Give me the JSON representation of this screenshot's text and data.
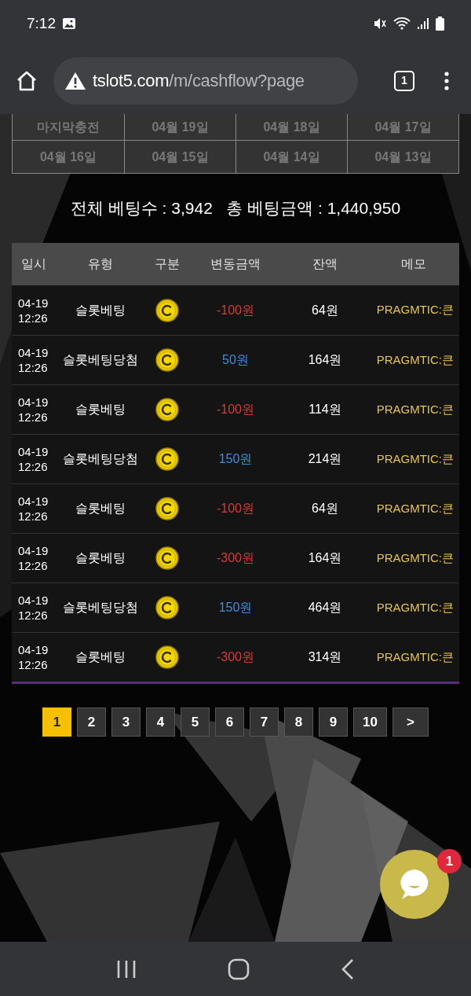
{
  "status_bar": {
    "time": "7:12"
  },
  "browser": {
    "url_host": "tslot5.com",
    "url_path": "/m/cashflow?page",
    "tab_count": "1"
  },
  "date_filters": [
    {
      "label": "마지막충전",
      "selected": false
    },
    {
      "label": "04월 19일",
      "selected": false
    },
    {
      "label": "04월 18일",
      "selected": false
    },
    {
      "label": "04월 17일",
      "selected": false
    },
    {
      "label": "04월 16일",
      "selected": false
    },
    {
      "label": "04월 15일",
      "selected": false
    },
    {
      "label": "04월 14일",
      "selected": false
    },
    {
      "label": "04월 13일",
      "selected": false
    }
  ],
  "summary": "전체 베팅수 : 3,942   총 베팅금액 : 1,440,950",
  "table": {
    "columns": [
      "일시",
      "유형",
      "구분",
      "변동금액",
      "잔액",
      "메모"
    ],
    "rows": [
      {
        "date": "04-19",
        "time": "12:26",
        "type": "슬롯베팅",
        "kind": "debit",
        "amount": "-100원",
        "balance": "64원",
        "memo": "PRAGMTIC:큰"
      },
      {
        "date": "04-19",
        "time": "12:26",
        "type": "슬롯베팅당첨",
        "kind": "credit",
        "amount": "50원",
        "balance": "164원",
        "memo": "PRAGMTIC:큰"
      },
      {
        "date": "04-19",
        "time": "12:26",
        "type": "슬롯베팅",
        "kind": "debit",
        "amount": "-100원",
        "balance": "114원",
        "memo": "PRAGMTIC:큰"
      },
      {
        "date": "04-19",
        "time": "12:26",
        "type": "슬롯베팅당첨",
        "kind": "credit",
        "amount": "150원",
        "balance": "214원",
        "memo": "PRAGMTIC:큰"
      },
      {
        "date": "04-19",
        "time": "12:26",
        "type": "슬롯베팅",
        "kind": "debit",
        "amount": "-100원",
        "balance": "64원",
        "memo": "PRAGMTIC:큰"
      },
      {
        "date": "04-19",
        "time": "12:26",
        "type": "슬롯베팅",
        "kind": "debit",
        "amount": "-300원",
        "balance": "164원",
        "memo": "PRAGMTIC:큰"
      },
      {
        "date": "04-19",
        "time": "12:26",
        "type": "슬롯베팅당첨",
        "kind": "credit",
        "amount": "150원",
        "balance": "464원",
        "memo": "PRAGMTIC:큰"
      },
      {
        "date": "04-19",
        "time": "12:26",
        "type": "슬롯베팅",
        "kind": "debit",
        "amount": "-300원",
        "balance": "314원",
        "memo": "PRAGMTIC:큰"
      }
    ]
  },
  "pagination": [
    {
      "label": "1",
      "selected": true
    },
    {
      "label": "2",
      "selected": false
    },
    {
      "label": "3",
      "selected": false
    },
    {
      "label": "4",
      "selected": false
    },
    {
      "label": "5",
      "selected": false
    },
    {
      "label": "6",
      "selected": false
    },
    {
      "label": "7",
      "selected": false
    },
    {
      "label": "8",
      "selected": false
    },
    {
      "label": "9",
      "selected": false
    },
    {
      "label": "10",
      "selected": false
    },
    {
      "label": ">",
      "selected": false
    }
  ],
  "chat": {
    "badge": "1"
  }
}
